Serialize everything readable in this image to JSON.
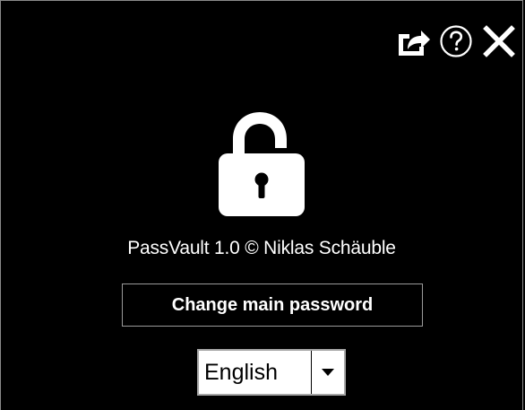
{
  "app": {
    "credits": "PassVault 1.0 © Niklas Schäuble"
  },
  "titlebar": {
    "icons": [
      "share-icon",
      "help-icon",
      "close-icon"
    ]
  },
  "main": {
    "lock_icon": "unlocked-padlock-icon",
    "change_password_label": "Change main password"
  },
  "language": {
    "selected": "English",
    "arrow_icon": "chevron-down-icon"
  },
  "colors": {
    "background": "#000000",
    "foreground": "#ffffff",
    "button_border": "#9a9a9a",
    "select_background": "#ffffff"
  }
}
